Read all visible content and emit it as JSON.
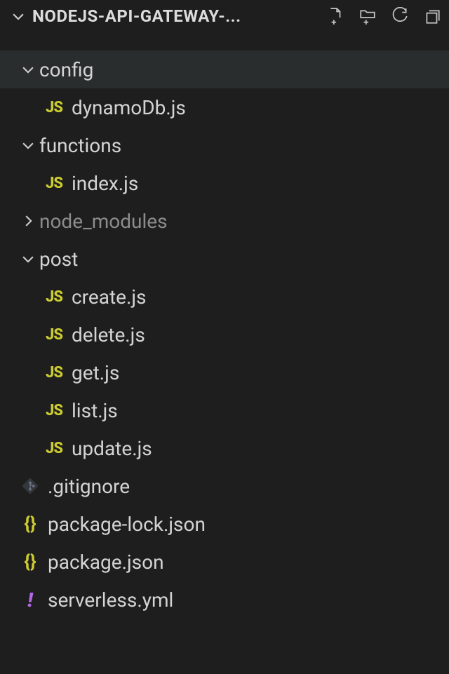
{
  "header": {
    "title": "NODEJS-API-GATEWAY-...",
    "actions": {
      "new_file": "new-file-icon",
      "new_folder": "new-folder-icon",
      "refresh": "refresh-icon",
      "collapse": "collapse-all-icon"
    }
  },
  "tree": [
    {
      "kind": "folder",
      "expanded": true,
      "depth": 1,
      "label": "config",
      "selected": true
    },
    {
      "kind": "file",
      "icon": "js",
      "depth": 2,
      "label": "dynamoDb.js"
    },
    {
      "kind": "folder",
      "expanded": true,
      "depth": 1,
      "label": "functions"
    },
    {
      "kind": "file",
      "icon": "js",
      "depth": 2,
      "label": "index.js"
    },
    {
      "kind": "folder",
      "expanded": false,
      "depth": 1,
      "label": "node_modules",
      "dim": true
    },
    {
      "kind": "folder",
      "expanded": true,
      "depth": 1,
      "label": "post"
    },
    {
      "kind": "file",
      "icon": "js",
      "depth": 2,
      "label": "create.js"
    },
    {
      "kind": "file",
      "icon": "js",
      "depth": 2,
      "label": "delete.js"
    },
    {
      "kind": "file",
      "icon": "js",
      "depth": 2,
      "label": "get.js"
    },
    {
      "kind": "file",
      "icon": "js",
      "depth": 2,
      "label": "list.js"
    },
    {
      "kind": "file",
      "icon": "js",
      "depth": 2,
      "label": "update.js"
    },
    {
      "kind": "file",
      "icon": "git",
      "depth": 1,
      "label": ".gitignore"
    },
    {
      "kind": "file",
      "icon": "json",
      "depth": 1,
      "label": "package-lock.json"
    },
    {
      "kind": "file",
      "icon": "json",
      "depth": 1,
      "label": "package.json"
    },
    {
      "kind": "file",
      "icon": "yml",
      "depth": 1,
      "label": "serverless.yml"
    }
  ],
  "icons": {
    "js": "JS",
    "json": "{}",
    "yml": "!"
  }
}
